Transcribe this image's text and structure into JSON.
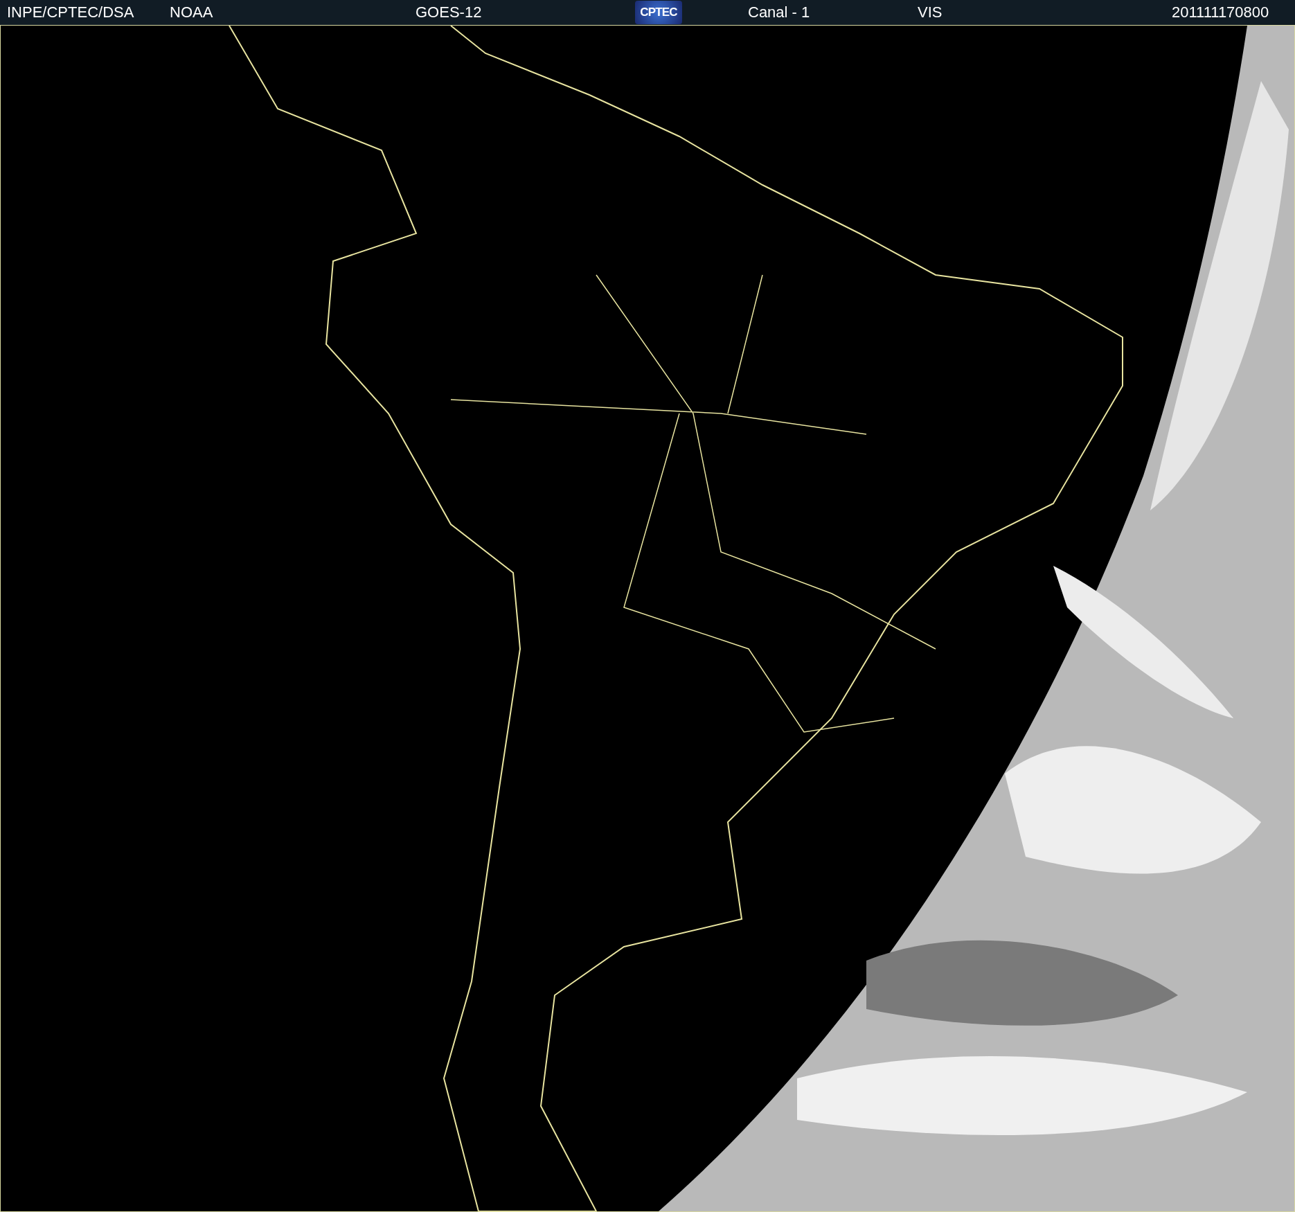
{
  "header": {
    "items": [
      {
        "kind": "text",
        "text": "INPE/CPTEC/DSA"
      },
      {
        "kind": "text",
        "text": "NOAA"
      },
      {
        "kind": "text",
        "text": "GOES-12"
      },
      {
        "kind": "logo",
        "text": "CPTEC"
      },
      {
        "kind": "text",
        "text": "Canal - 1"
      },
      {
        "kind": "text",
        "text": "VIS"
      },
      {
        "kind": "text",
        "text": "201111170800"
      }
    ]
  }
}
